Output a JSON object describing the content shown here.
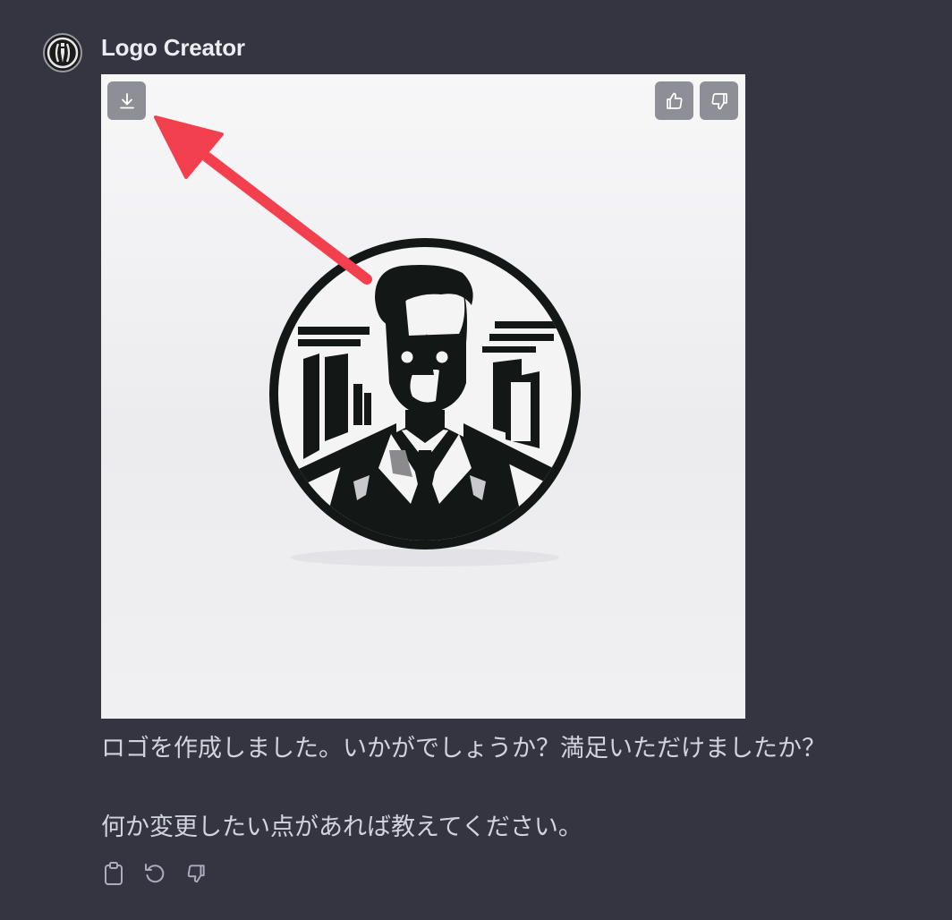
{
  "message": {
    "author": "Logo Creator",
    "avatar_icon": "logo-creator-avatar-icon",
    "paragraphs": [
      "ロゴを作成しました。いかがでしょうか？満足いただけましたか？",
      "何か変更したい点があれば教えてください。"
    ]
  },
  "image_actions": {
    "download_icon": "download-icon",
    "like_icon": "thumbs-up-icon",
    "dislike_icon": "thumbs-down-icon"
  },
  "message_actions": {
    "copy_icon": "clipboard-icon",
    "regenerate_icon": "regenerate-icon",
    "dislike_icon": "thumbs-down-icon"
  },
  "colors": {
    "background": "#343541",
    "text": "#d1d5db",
    "annotation_arrow": "#f2404e",
    "image_button": "#8e8e96"
  }
}
